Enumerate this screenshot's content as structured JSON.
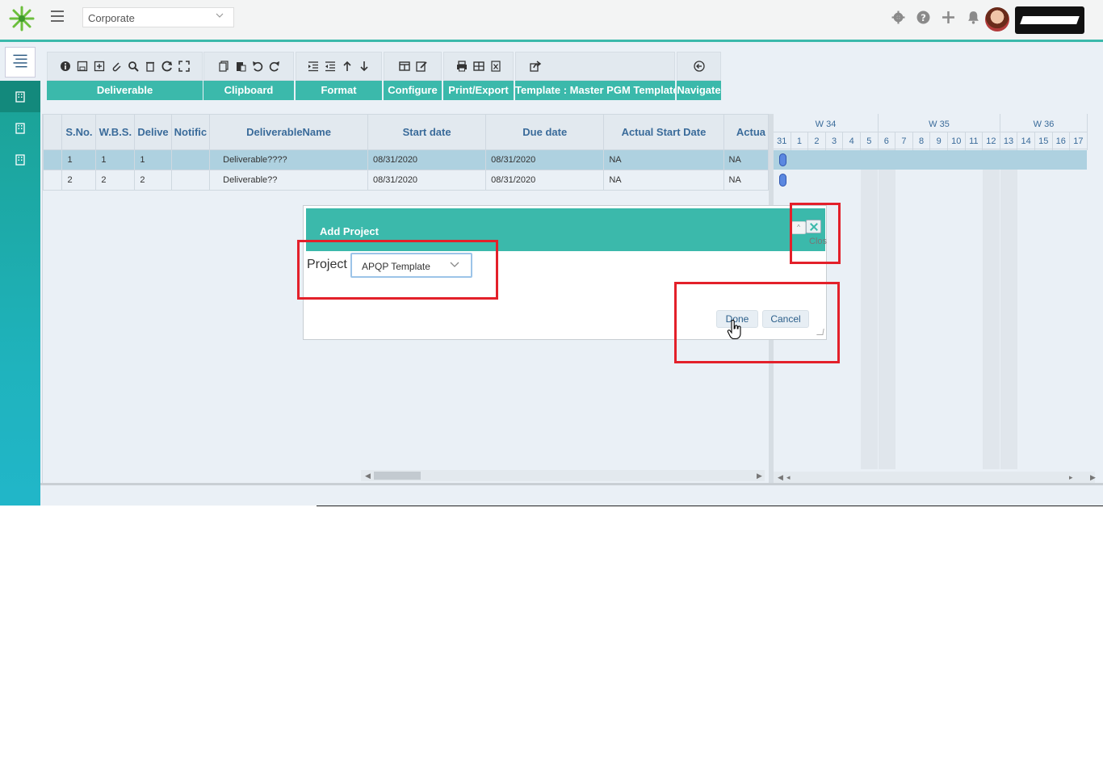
{
  "header": {
    "org_selector": "Corporate"
  },
  "ribbon": {
    "groups": [
      {
        "label": "Deliverable"
      },
      {
        "label": "Clipboard"
      },
      {
        "label": "Format"
      },
      {
        "label": "Configure"
      },
      {
        "label": "Print/Export"
      },
      {
        "label": "Template : Master PGM Template"
      },
      {
        "label": "Navigate"
      }
    ]
  },
  "grid": {
    "columns": [
      "",
      "S.No.",
      "W.B.S.",
      "Deliverable #",
      "Notific",
      "DeliverableName",
      "Start date",
      "Due date",
      "Actual Start Date",
      "Actua"
    ],
    "column_display": [
      "",
      "S.No.",
      "W.B.S.",
      "Delive",
      "Notific",
      "DeliverableName",
      "Start date",
      "Due date",
      "Actual Start Date",
      "Actua"
    ],
    "rows": [
      {
        "sno": "1",
        "wbs": "1",
        "deliv": "1",
        "notif": "",
        "name": "Deliverable????",
        "start": "08/31/2020",
        "due": "08/31/2020",
        "actual_start": "NA",
        "actual": "NA"
      },
      {
        "sno": "2",
        "wbs": "2",
        "deliv": "2",
        "notif": "",
        "name": "Deliverable??",
        "start": "08/31/2020",
        "due": "08/31/2020",
        "actual_start": "NA",
        "actual": "NA"
      }
    ]
  },
  "gantt": {
    "weeks": [
      "W 34",
      "W 35",
      "W 36"
    ],
    "days": [
      "31",
      "1",
      "2",
      "3",
      "4",
      "5",
      "6",
      "7",
      "8",
      "9",
      "10",
      "11",
      "12",
      "13",
      "14",
      "15",
      "16",
      "17"
    ]
  },
  "dialog": {
    "title": "Add Project",
    "close_tooltip": "Clos",
    "project_label": "Project",
    "project_value": "APQP Template",
    "done_label": "Done",
    "cancel_label": "Cancel"
  },
  "colors": {
    "accent": "#3bb9ab",
    "annotation": "#e3202a",
    "selected_row": "#aed1e0"
  }
}
